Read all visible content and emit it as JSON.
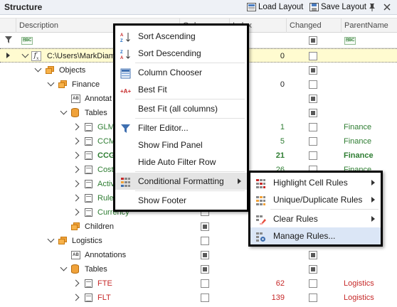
{
  "panel": {
    "title": "Structure",
    "load_layout": "Load Layout",
    "save_layout": "Save Layout"
  },
  "columns": {
    "description": "Description",
    "order": "Order",
    "index": "Index",
    "changed": "Changed",
    "parent_name": "ParentName"
  },
  "root": {
    "label": "C:\\Users\\MarkDiam",
    "index": "0"
  },
  "rows": {
    "objects": "Objects",
    "finance": "Finance",
    "finance_index": "0",
    "annotations_short": "Annotat",
    "tables": "Tables",
    "glm": "GLM",
    "glm_index": "1",
    "glm_parent": "Finance",
    "ccm": "CCM",
    "ccm_index": "5",
    "ccm_parent": "Finance",
    "ccg": "CCG",
    "ccg_index": "21",
    "ccg_parent": "Finance",
    "cost": "Cost",
    "cost_index": "26",
    "cost_parent": "Finance",
    "activ": "Activ",
    "rule": "Rule",
    "currency": "Currency",
    "children": "Children",
    "logistics": "Logistics",
    "annotations": "Annotations",
    "tables2": "Tables",
    "fte": "FTE",
    "fte_index": "62",
    "fte_parent": "Logistics",
    "flt": "FLT",
    "flt_index": "139",
    "flt_parent": "Logistics"
  },
  "context_menu": {
    "sort_ascending": "Sort Ascending",
    "sort_descending": "Sort Descending",
    "column_chooser": "Column Chooser",
    "best_fit": "Best Fit",
    "best_fit_all": "Best Fit (all columns)",
    "filter_editor": "Filter Editor...",
    "show_find_panel": "Show Find Panel",
    "hide_auto_filter_row": "Hide Auto Filter Row",
    "conditional_formatting": "Conditional Formatting",
    "show_footer": "Show Footer"
  },
  "submenu": {
    "highlight_cell_rules": "Highlight Cell Rules",
    "unique_duplicate_rules": "Unique/Duplicate Rules",
    "clear_rules": "Clear Rules",
    "manage_rules": "Manage Rules..."
  },
  "colors": {
    "green_text": "#2e7d32",
    "red_text": "#c62828",
    "menu_highlight": "#dbe6f6",
    "menu_hover": "#e4e4e4",
    "selected_row": "#fffbd0"
  }
}
